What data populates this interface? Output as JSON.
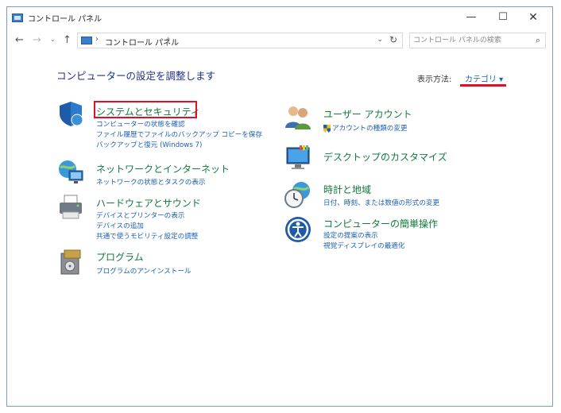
{
  "window": {
    "title": "コントロール パネル",
    "minimize_glyph": "—",
    "maximize_glyph": "☐",
    "close_glyph": "✕"
  },
  "nav": {
    "back_glyph": "←",
    "forward_glyph": "→",
    "recent_glyph": "⌄",
    "up_glyph": "↑",
    "breadcrumb_sep": "›",
    "address_text": "コントロール パネル",
    "dropdown_glyph": "⌄",
    "refresh_glyph": "↻",
    "search_placeholder": "コントロール パネルの検索",
    "search_glyph": "⌕"
  },
  "main": {
    "heading": "コンピューターの設定を調整します",
    "view_by_label": "表示方法:",
    "view_by_value": "カテゴリ ▾"
  },
  "categories_left": [
    {
      "icon": "shield-icon",
      "title": "システムとセキュリティ",
      "links": [
        "コンピューターの状態を確認",
        "ファイル履歴でファイルのバックアップ コピーを保存",
        "バックアップと復元 (Windows 7)"
      ]
    },
    {
      "icon": "network-globe-icon",
      "title": "ネットワークとインターネット",
      "links": [
        "ネットワークの状態とタスクの表示"
      ]
    },
    {
      "icon": "printer-icon",
      "title": "ハードウェアとサウンド",
      "links": [
        "デバイスとプリンターの表示",
        "デバイスの追加",
        "共通で使うモビリティ設定の調整"
      ]
    },
    {
      "icon": "programs-icon",
      "title": "プログラム",
      "links": [
        "プログラムのアンインストール"
      ]
    }
  ],
  "categories_right": [
    {
      "icon": "users-icon",
      "title": "ユーザー アカウント",
      "links": [
        "アカウントの種類の変更"
      ]
    },
    {
      "icon": "personalize-icon",
      "title": "デスクトップのカスタマイズ",
      "links": []
    },
    {
      "icon": "clock-globe-icon",
      "title": "時計と地域",
      "links": [
        "日付、時刻、または数値の形式の変更"
      ]
    },
    {
      "icon": "ease-of-access-icon",
      "title": "コンピューターの簡単操作",
      "links": [
        "設定の提案の表示",
        "視覚ディスプレイの最適化"
      ]
    }
  ],
  "colors": {
    "heading": "#1e3287",
    "category_title": "#0f7a3a",
    "link": "#1a5fb4",
    "highlight": "#e0102a"
  }
}
